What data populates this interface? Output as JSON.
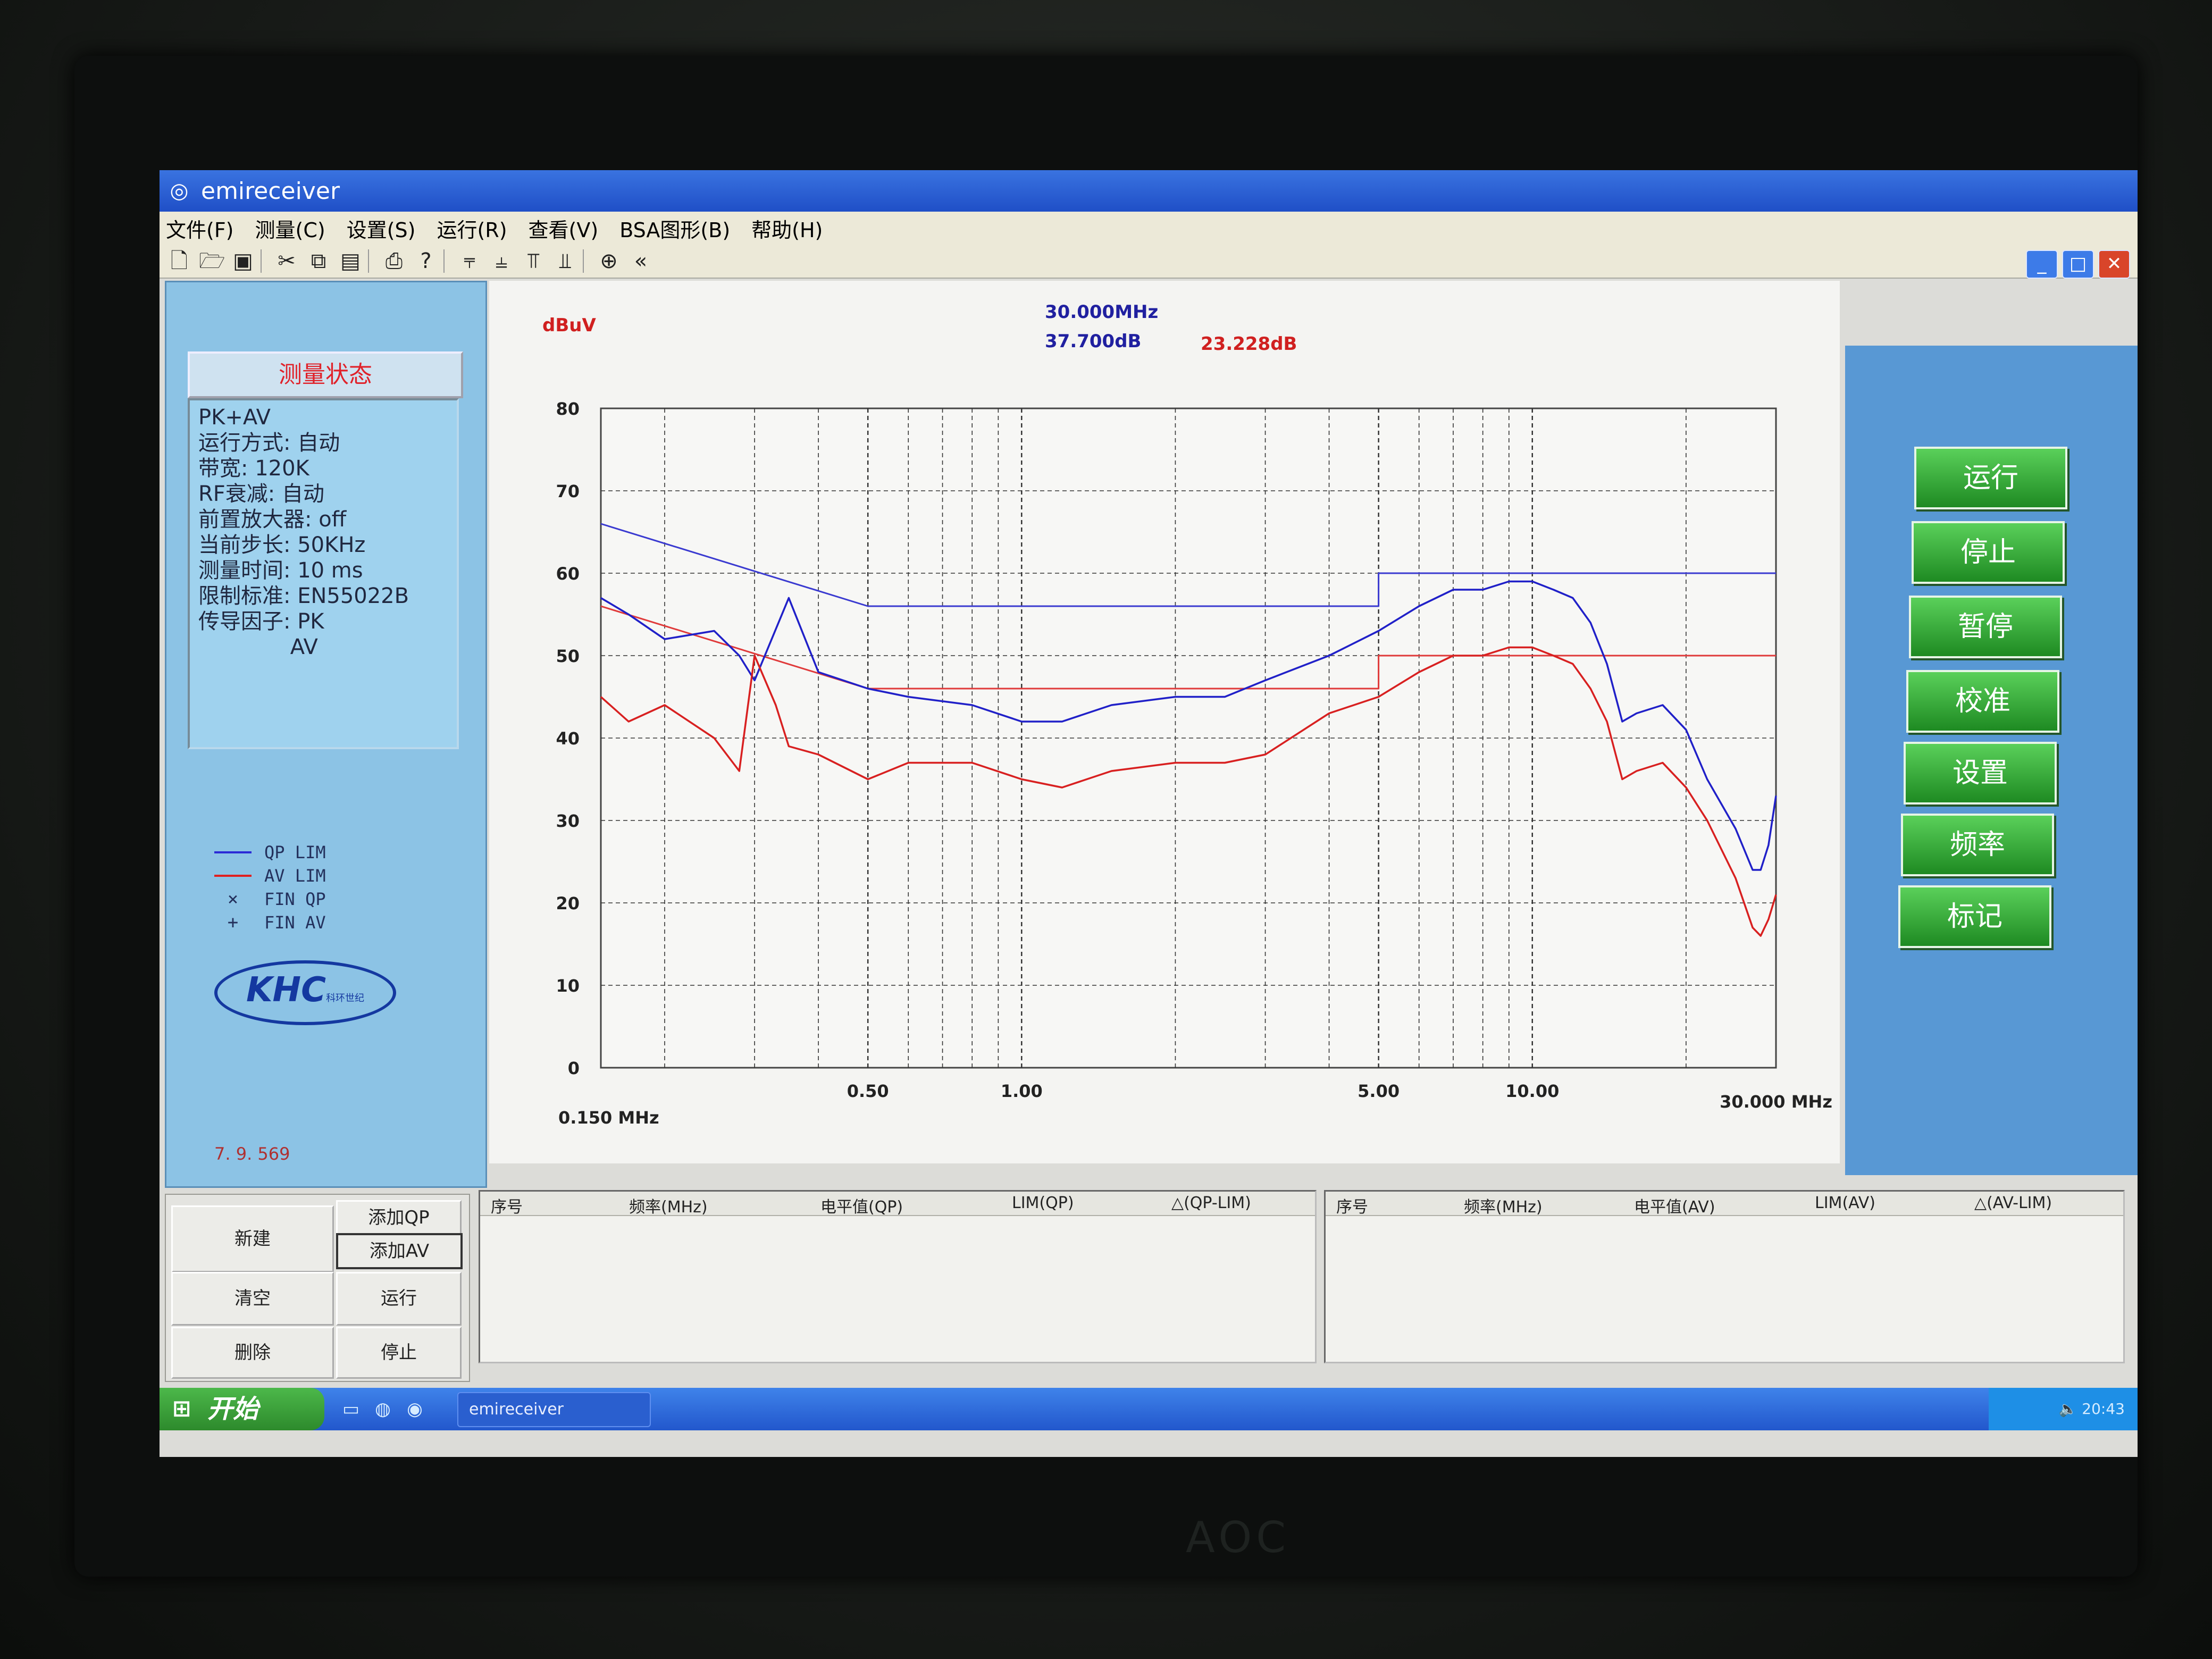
{
  "window": {
    "title": "emireceiver"
  },
  "menu": [
    "文件(F)",
    "测量(C)",
    "设置(S)",
    "运行(R)",
    "查看(V)",
    "BSA图形(B)",
    "帮助(H)"
  ],
  "toolbar_icons": [
    "new-icon",
    "open-icon",
    "save-icon",
    "cut-icon",
    "copy-icon",
    "paste-icon",
    "print-icon",
    "help-icon",
    "align-top-icon",
    "align-middle-icon",
    "align-bottom-icon",
    "align-baseline-icon",
    "zoom-icon",
    "back-icon"
  ],
  "status": {
    "header": "测量状态",
    "lines": [
      "PK+AV",
      "运行方式: 自动",
      "带宽: 120K",
      "RF衰减: 自动",
      "前置放大器: off",
      "当前步长: 50KHz",
      "测量时间: 10 ms",
      "限制标准: EN55022B",
      "传导因子: PK",
      "　　　　 AV"
    ]
  },
  "legend": [
    {
      "symbol": "line",
      "color": "#2b2bd6",
      "label": "QP LIM"
    },
    {
      "symbol": "line",
      "color": "#e02020",
      "label": "AV LIM"
    },
    {
      "symbol": "×",
      "color": "#202040",
      "label": "FIN QP"
    },
    {
      "symbol": "+",
      "color": "#202040",
      "label": "FIN AV"
    }
  ],
  "logo": {
    "text": "KHC",
    "subtitle": "科环世纪"
  },
  "version": "7. 9. 569",
  "marker": {
    "freq": "30.000MHz",
    "level1": "37.700dB",
    "level2": "23.228dB"
  },
  "chart_data": {
    "type": "line",
    "x_scale": "log",
    "xlim": [
      0.15,
      30
    ],
    "ylim": [
      0,
      80
    ],
    "ylabel": "dBuV",
    "x_unit": "MHz",
    "x_tick_labels": [
      {
        "x": 0.15,
        "label": "0.150 MHz"
      },
      {
        "x": 0.5,
        "label": "0.50"
      },
      {
        "x": 1,
        "label": "1.00"
      },
      {
        "x": 5,
        "label": "5.00"
      },
      {
        "x": 10,
        "label": "10.00"
      },
      {
        "x": 30,
        "label": "30.000 MHz"
      }
    ],
    "y_ticks": [
      0,
      10,
      20,
      30,
      40,
      50,
      60,
      70,
      80
    ],
    "grid": true,
    "series": [
      {
        "name": "QP LIM",
        "color": "#3a3ad0",
        "x": [
          0.15,
          0.5,
          5,
          5,
          30
        ],
        "y": [
          66,
          56,
          56,
          60,
          60
        ]
      },
      {
        "name": "AV LIM",
        "color": "#e03a3a",
        "x": [
          0.15,
          0.5,
          5,
          5,
          30
        ],
        "y": [
          56,
          46,
          46,
          50,
          50
        ]
      },
      {
        "color": "#2020c8",
        "x": [
          0.15,
          0.17,
          0.2,
          0.25,
          0.28,
          0.3,
          0.35,
          0.4,
          0.5,
          0.6,
          0.8,
          1,
          1.2,
          1.5,
          2,
          2.5,
          3,
          4,
          5,
          6,
          7,
          8,
          9,
          10,
          11,
          12,
          13,
          14,
          15,
          16,
          18,
          20,
          22,
          25,
          27,
          28,
          29,
          30
        ],
        "y": [
          57,
          55,
          52,
          53,
          50,
          47,
          57,
          48,
          46,
          45,
          44,
          42,
          42,
          44,
          45,
          45,
          47,
          50,
          53,
          56,
          58,
          58,
          59,
          59,
          58,
          57,
          54,
          49,
          42,
          43,
          44,
          41,
          35,
          29,
          24,
          24,
          27,
          33
        ]
      },
      {
        "color": "#d82020",
        "x": [
          0.15,
          0.17,
          0.2,
          0.25,
          0.28,
          0.3,
          0.33,
          0.35,
          0.4,
          0.5,
          0.6,
          0.8,
          1,
          1.2,
          1.5,
          2,
          2.5,
          3,
          4,
          5,
          6,
          7,
          8,
          9,
          10,
          11,
          12,
          13,
          14,
          15,
          16,
          18,
          20,
          22,
          25,
          27,
          28,
          29,
          30
        ],
        "y": [
          45,
          42,
          44,
          40,
          36,
          50,
          44,
          39,
          38,
          35,
          37,
          37,
          35,
          34,
          36,
          37,
          37,
          38,
          43,
          45,
          48,
          50,
          50,
          51,
          51,
          50,
          49,
          46,
          42,
          35,
          36,
          37,
          34,
          30,
          23,
          17,
          16,
          18,
          21
        ]
      }
    ]
  },
  "right_buttons": [
    "运行",
    "停止",
    "暂停",
    "校准",
    "设置",
    "频率",
    "标记"
  ],
  "bottom_buttons": {
    "new": "新建",
    "add_qp": "添加QP",
    "add_av": "添加AV",
    "clear": "清空",
    "run": "运行",
    "delete": "删除",
    "stop": "停止"
  },
  "table_qp": {
    "headers": [
      "序号",
      "频率(MHz)",
      "电平值(QP)",
      "LIM(QP)",
      "△(QP-LIM)"
    ]
  },
  "table_av": {
    "headers": [
      "序号",
      "频率(MHz)",
      "电平值(AV)",
      "LIM(AV)",
      "△(AV-LIM)"
    ]
  },
  "taskbar": {
    "start": "开始",
    "item": "emireceiver",
    "clock": "20:43"
  }
}
